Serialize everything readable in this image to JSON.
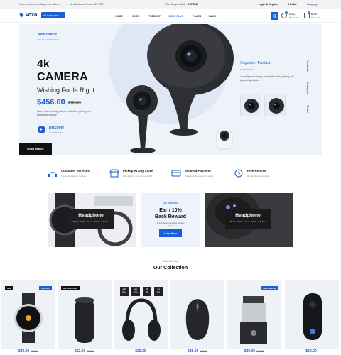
{
  "topbar": {
    "msg1": "Voxo ecommerce always free delivery",
    "msg2": "New Customer Extra 30% OFF",
    "coupon_label": "Offer Coupon Code:",
    "coupon_code": "OEF4036",
    "login": "Login & Register",
    "currency": "$ Dollar",
    "language": "Language"
  },
  "header": {
    "logo": "Voxo",
    "categories": "All Categories",
    "nav": [
      "HOME",
      "SHOP",
      "PRODUCT",
      "VOXO PLUS",
      "PAGES",
      "BLOG"
    ],
    "wishlist_label": "Empty",
    "wishlist_sub": "Wish List",
    "wishlist_count": "0",
    "cart_amount": "$0.00",
    "cart_sub": "Your cart",
    "cart_count": "0"
  },
  "hero": {
    "new_offer": "NEW OFFER",
    "offer_sub": "Buy One Get One Free",
    "line1": "4k",
    "line2": "CAMERA",
    "line3": "Wishing For Is Right",
    "price": "$456.00",
    "old_price": "$400.00",
    "desc": "Lorem Ipsum is simply dummy text of the printing and typesetting industry.",
    "discover": "Discover",
    "discover_sub": "Our Collection",
    "show_details": "Show Details",
    "suggestion_title": "Sugestion Product",
    "suggestion_sub": "Our Collection",
    "suggestion_desc": "Lorem Ipsum is simply dummy text of the printing and typesetting industry.",
    "social": [
      "Facebook",
      "Instagram",
      "Twitter"
    ]
  },
  "services": [
    {
      "title": "Customer Services",
      "sub": "Top notch customer services"
    },
    {
      "title": "Pickup At Any Store",
      "sub": "Free shipping on orders over $65"
    },
    {
      "title": "Secured Payment",
      "sub": "We accept all major credit cards"
    },
    {
      "title": "Free Returns",
      "sub": "30-days free return policy"
    }
  ],
  "promos": {
    "left_title": "Headphone",
    "left_sub": "BUY ONE GET ONE FREE",
    "mid_tag": "Get Rewarded",
    "mid_title1": "Earn 10%",
    "mid_title2": "Back Reward",
    "mid_sub": "Subscribe & Innovative product styles",
    "mid_button": "Learn More",
    "right_title": "Headphone",
    "right_sub": "BUY ONE GET ONE FREE"
  },
  "collection": {
    "tag": "Just For You",
    "title": "Our Collection",
    "countdown": [
      {
        "n": "432",
        "l": "Days"
      },
      {
        "n": "05",
        "l": "Hour"
      },
      {
        "n": "40",
        "l": "Min"
      },
      {
        "n": "14",
        "l": "Sec"
      }
    ],
    "products": [
      {
        "badge_left": "New",
        "badge_right": "50% OFF",
        "price": "$49.00",
        "old": "$52.00"
      },
      {
        "badge_left": "ON DISCOUNT",
        "badge_right": "",
        "price": "$32.00",
        "old": "$50.00"
      },
      {
        "badge_left": "",
        "badge_right": "",
        "price": "$25.00",
        "old": ""
      },
      {
        "badge_left": "",
        "badge_right": "",
        "price": "$28.00",
        "old": "$35.00"
      },
      {
        "badge_left": "",
        "badge_right": "BEST VALUE",
        "price": "$35.00",
        "old": "$49.00"
      },
      {
        "badge_left": "",
        "badge_right": "",
        "price": "$52.00",
        "old": ""
      }
    ]
  }
}
